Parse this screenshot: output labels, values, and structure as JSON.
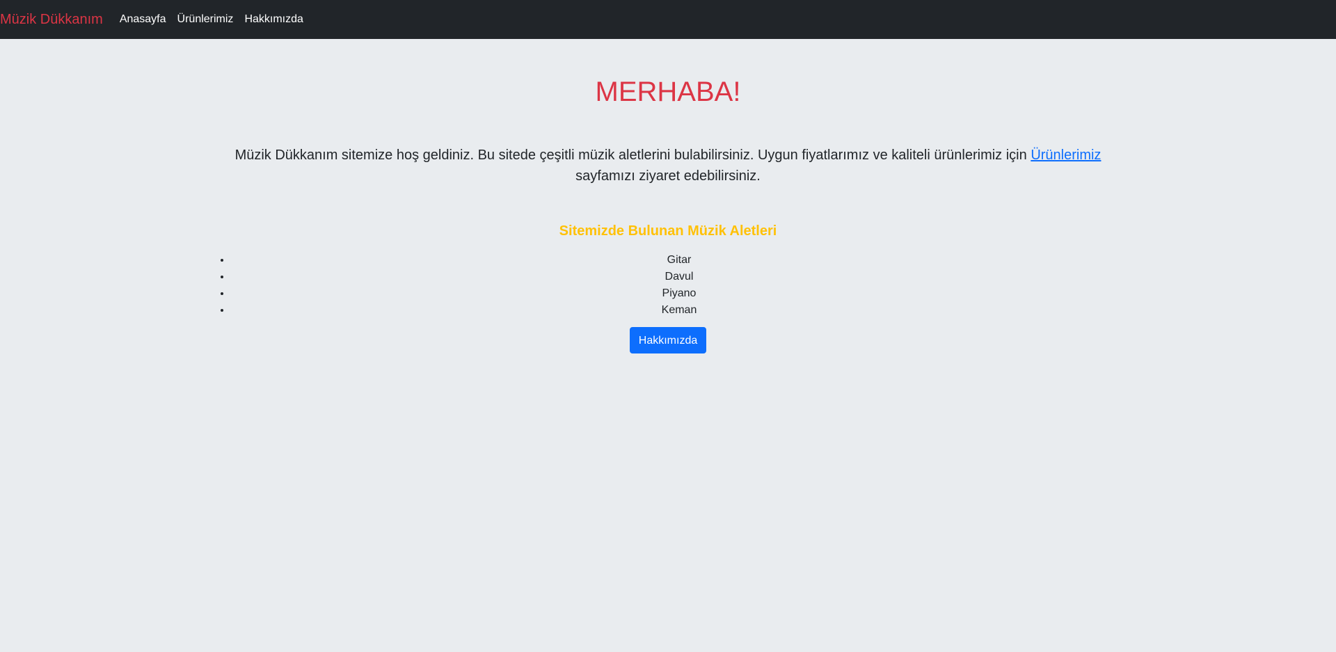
{
  "navbar": {
    "brand": "Müzik Dükkanım",
    "links": [
      "Anasayfa",
      "Ürünlerimiz",
      "Hakkımızda"
    ]
  },
  "main": {
    "heading": "MERHABA!",
    "intro_before": "Müzik Dükkanım sitemize hoş geldiniz. Bu sitede çeşitli müzik aletlerini bulabilirsiniz. Uygun fiyatlarımız ve kaliteli ürünlerimiz için ",
    "intro_link": "Ürünlerimiz",
    "intro_after": " sayfamızı ziyaret edebilirsiniz.",
    "subheading": "Sitemizde Bulunan Müzik Aletleri",
    "instruments": [
      "Gitar",
      "Davul",
      "Piyano",
      "Keman"
    ],
    "button_label": "Hakkımızda"
  },
  "colors": {
    "navbar_bg": "#212529",
    "brand": "#dc3545",
    "heading": "#dc3545",
    "subheading": "#ffc107",
    "link": "#0d6efd",
    "button_bg": "#0d6efd",
    "page_bg": "#e9ecef"
  }
}
